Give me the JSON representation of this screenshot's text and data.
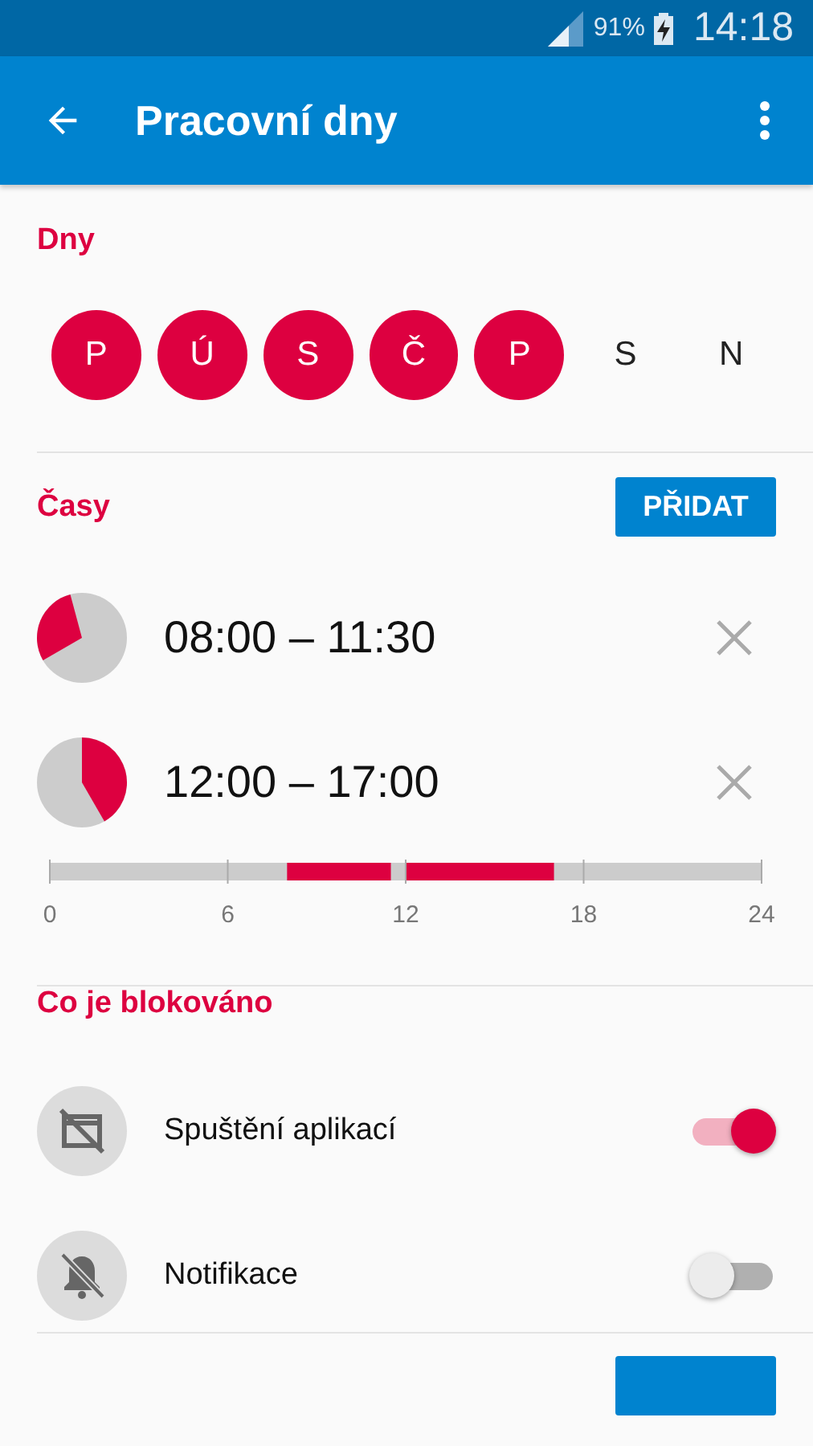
{
  "status_bar": {
    "battery": "91%",
    "time": "14:18"
  },
  "app_bar": {
    "title": "Pracovní dny"
  },
  "days_section": {
    "title": "Dny",
    "days": [
      {
        "label": "P",
        "selected": true
      },
      {
        "label": "Ú",
        "selected": true
      },
      {
        "label": "S",
        "selected": true
      },
      {
        "label": "Č",
        "selected": true
      },
      {
        "label": "P",
        "selected": true
      },
      {
        "label": "S",
        "selected": false
      },
      {
        "label": "N",
        "selected": false
      }
    ]
  },
  "times_section": {
    "title": "Časy",
    "add_button": "PŘIDAT",
    "intervals": [
      {
        "text": "08:00 – 11:30"
      },
      {
        "text": "12:00 – 17:00"
      }
    ],
    "timeline": {
      "ticks": [
        "0",
        "6",
        "12",
        "18",
        "24"
      ]
    }
  },
  "blocked_section": {
    "title": "Co je blokováno",
    "items": [
      {
        "kind": "apps",
        "label": "Spuštění aplikací",
        "on": true
      },
      {
        "kind": "notifications",
        "label": "Notifikace",
        "on": false
      }
    ]
  }
}
